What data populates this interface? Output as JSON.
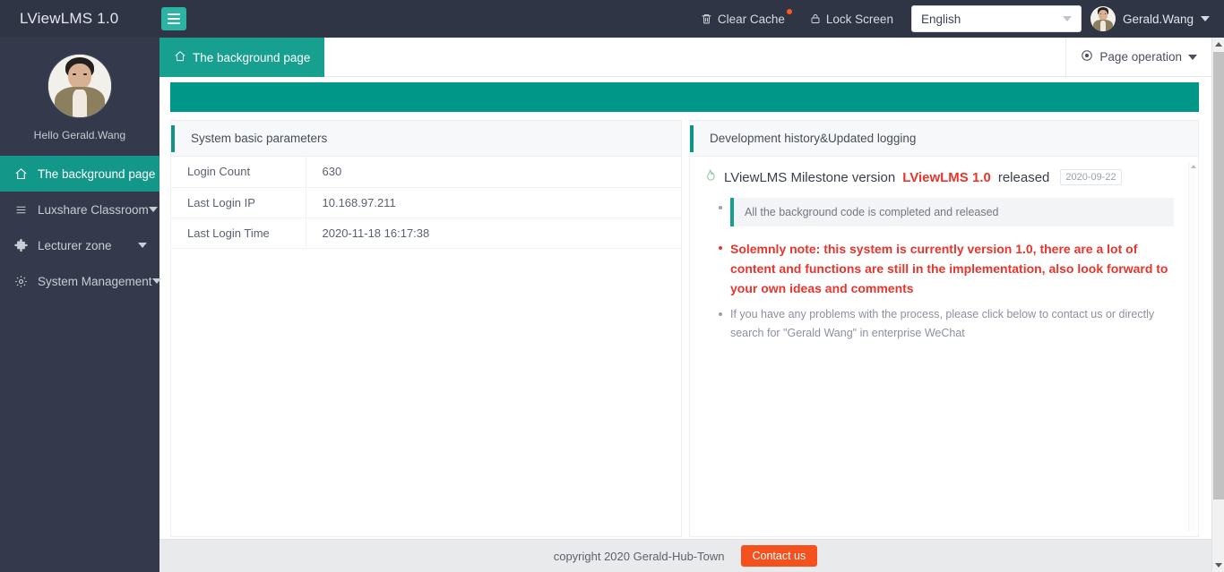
{
  "header": {
    "brand": "LViewLMS 1.0",
    "collapse_icon": "hamburger-icon",
    "clear_cache": "Clear Cache",
    "lock_screen": "Lock Screen",
    "language_value": "English",
    "user_name": "Gerald.Wang"
  },
  "sidebar": {
    "greeting": "Hello Gerald.Wang",
    "items": [
      {
        "label": "The background page",
        "icon": "home-icon",
        "active": true,
        "has_arrow": false
      },
      {
        "label": "Luxshare Classroom",
        "icon": "list-icon",
        "active": false,
        "has_arrow": true
      },
      {
        "label": "Lecturer zone",
        "icon": "puzzle-icon",
        "active": false,
        "has_arrow": true
      },
      {
        "label": "System Management",
        "icon": "gear-icon",
        "active": false,
        "has_arrow": true
      }
    ]
  },
  "tabs": {
    "active_tab": "The background page",
    "tab_icon": "home-icon",
    "page_operation": "Page operation"
  },
  "left_panel": {
    "title": "System basic parameters",
    "rows": [
      {
        "key": "Login Count",
        "value": "630"
      },
      {
        "key": "Last Login IP",
        "value": "10.168.97.211"
      },
      {
        "key": "Last Login Time",
        "value": "2020-11-18 16:17:38"
      }
    ]
  },
  "right_panel": {
    "title": "Development history&Updated logging",
    "log_icon": "fire-icon",
    "log_title_prefix": "LViewLMS Milestone version",
    "log_title_version": "LViewLMS 1.0",
    "log_title_suffix": "released",
    "log_date": "2020-09-22",
    "note_box": "All the background code is completed and released",
    "red_note": "Solemnly note: this system is currently version 1.0, there are a lot of content and functions are still in the implementation, also look forward to your own ideas and comments",
    "gray_note": "If you have any problems with the process, please click below to contact us or directly search for \"Gerald Wang\" in enterprise WeChat"
  },
  "footer": {
    "copyright": "copyright 2020 Gerald-Hub-Town",
    "contact_button": "Contact us"
  },
  "colors": {
    "accent_teal": "#009688",
    "header_dark": "#2f3545",
    "sidebar_dark": "#343a4b",
    "danger_red": "#e8352c",
    "contact_orange": "#f4511e",
    "badge_orange": "#ff5722"
  }
}
